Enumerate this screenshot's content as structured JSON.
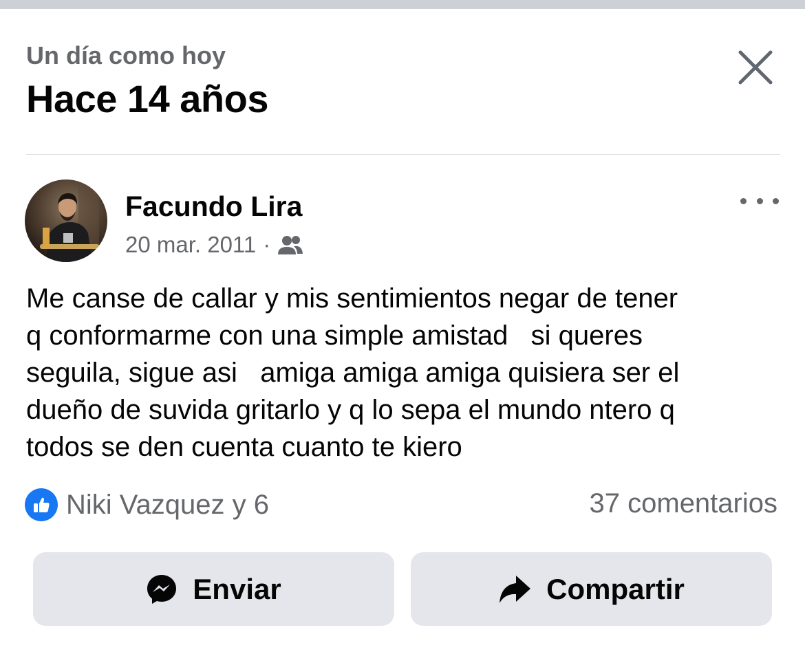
{
  "header": {
    "subtitle": "Un día como hoy",
    "title": "Hace 14 años",
    "close_icon": "close-icon"
  },
  "post": {
    "author": "Facundo Lira",
    "date": "20 mar. 2011",
    "separator": "·",
    "audience_icon": "friends-icon",
    "more_icon": "more-icon",
    "text": "Me canse de callar y mis sentimientos negar de tener\nq conformarme con una simple amistad   si queres\nseguila, sigue asi   amiga amiga amiga quisiera ser el\ndueño de suvida gritarlo y q lo sepa el mundo ntero q\ntodos se den cuenta cuanto te kiero",
    "reactions": {
      "icon": "like-icon",
      "text": "Niki Vazquez y 6",
      "color": "#1877f2"
    },
    "comments": "37 comentarios"
  },
  "actions": {
    "send": {
      "label": "Enviar",
      "icon": "messenger-icon"
    },
    "share": {
      "label": "Compartir",
      "icon": "share-icon"
    }
  },
  "colors": {
    "secondary_text": "#65676b",
    "button_bg": "#e4e6eb",
    "accent": "#1877f2"
  }
}
